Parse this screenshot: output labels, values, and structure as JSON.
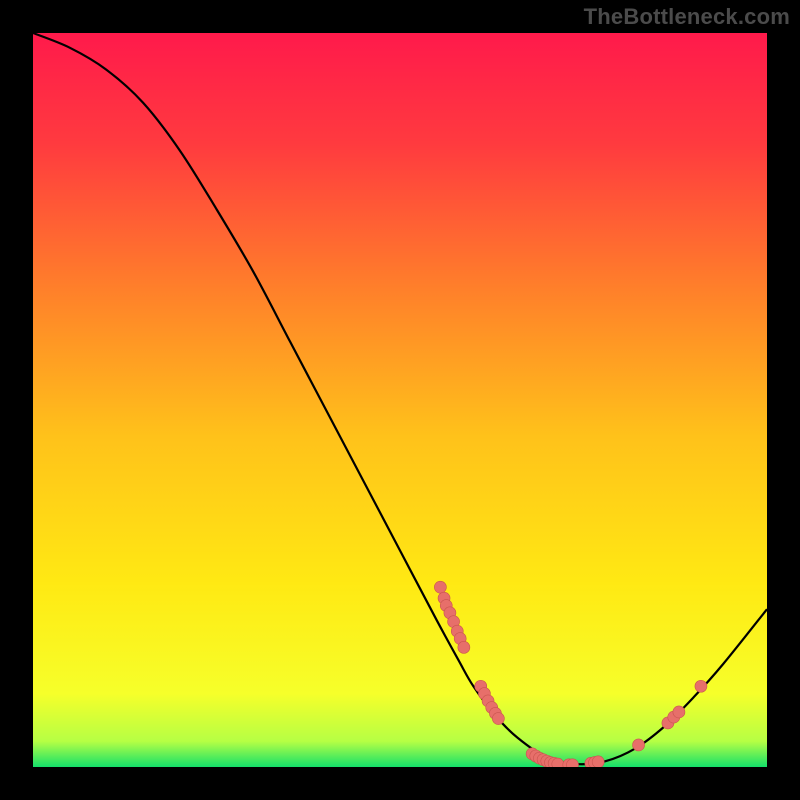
{
  "watermark": "TheBottleneck.com",
  "colors": {
    "frame": "#000000",
    "grad_top": "#ff1a4b",
    "grad_mid": "#ffde00",
    "grad_bottom": "#14e06a",
    "curve": "#000000",
    "point_fill": "#e76f6a",
    "point_stroke": "#c9544f"
  },
  "chart_data": {
    "type": "line",
    "title": "",
    "xlabel": "",
    "ylabel": "",
    "xlim": [
      0,
      100
    ],
    "ylim": [
      0,
      100
    ],
    "curve": {
      "x": [
        0,
        5,
        10,
        15,
        20,
        25,
        30,
        35,
        40,
        45,
        50,
        55,
        58,
        60,
        63,
        66,
        70,
        74,
        78,
        82,
        86,
        90,
        94,
        100
      ],
      "y": [
        100,
        98,
        95,
        90.5,
        84,
        76,
        67.5,
        58,
        48.5,
        39,
        29.5,
        20,
        14.5,
        11,
        7,
        4,
        1.3,
        0.4,
        0.8,
        2.5,
        5.5,
        9.5,
        14,
        21.5
      ]
    },
    "points": [
      {
        "x": 55.5,
        "y": 24.5
      },
      {
        "x": 56.0,
        "y": 23.0
      },
      {
        "x": 56.3,
        "y": 22.0
      },
      {
        "x": 56.8,
        "y": 21.0
      },
      {
        "x": 57.3,
        "y": 19.8
      },
      {
        "x": 57.8,
        "y": 18.5
      },
      {
        "x": 58.2,
        "y": 17.5
      },
      {
        "x": 58.7,
        "y": 16.3
      },
      {
        "x": 61.0,
        "y": 11.0
      },
      {
        "x": 61.5,
        "y": 10.0
      },
      {
        "x": 62.0,
        "y": 9.0
      },
      {
        "x": 62.5,
        "y": 8.1
      },
      {
        "x": 63.0,
        "y": 7.3
      },
      {
        "x": 63.4,
        "y": 6.6
      },
      {
        "x": 68.0,
        "y": 1.8
      },
      {
        "x": 68.5,
        "y": 1.5
      },
      {
        "x": 69.0,
        "y": 1.2
      },
      {
        "x": 69.5,
        "y": 1.0
      },
      {
        "x": 70.0,
        "y": 0.8
      },
      {
        "x": 70.5,
        "y": 0.6
      },
      {
        "x": 71.0,
        "y": 0.5
      },
      {
        "x": 71.5,
        "y": 0.4
      },
      {
        "x": 73.0,
        "y": 0.3
      },
      {
        "x": 73.5,
        "y": 0.3
      },
      {
        "x": 76.0,
        "y": 0.5
      },
      {
        "x": 76.5,
        "y": 0.6
      },
      {
        "x": 77.0,
        "y": 0.7
      },
      {
        "x": 82.5,
        "y": 3.0
      },
      {
        "x": 86.5,
        "y": 6.0
      },
      {
        "x": 87.3,
        "y": 6.8
      },
      {
        "x": 88.0,
        "y": 7.5
      },
      {
        "x": 91.0,
        "y": 11.0
      }
    ]
  }
}
